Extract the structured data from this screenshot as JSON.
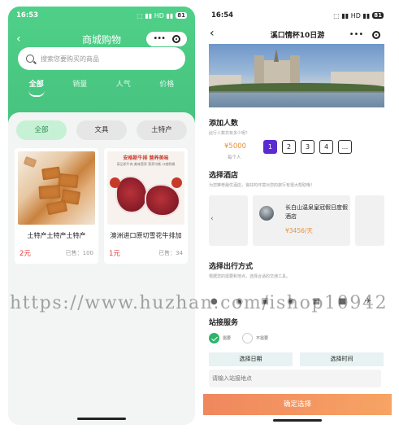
{
  "left": {
    "status": {
      "time": "16:53",
      "signal": "⬚ ▮▮ HD ▮▮",
      "battery": "81"
    },
    "nav": {
      "title": "商城购物",
      "capsule_dots": "•••"
    },
    "search": {
      "placeholder": "搜索您要购买的商品"
    },
    "tabs": [
      "全部",
      "销量",
      "人气",
      "价格"
    ],
    "chips": [
      "全部",
      "文具",
      "土特产"
    ],
    "products": [
      {
        "name": "土特产土特产土特产",
        "price": "2元",
        "sold": "已售：100"
      },
      {
        "name": "澳洲进口原切雪花牛排加",
        "price": "1元",
        "sold": "已售：34",
        "banner": "安格斯牛排 营养美味",
        "banner_sub": "高品质牛肉 美味营养 营养均衡 口感鲜嫩"
      }
    ]
  },
  "right": {
    "status": {
      "time": "16:54",
      "signal": "⬚ ▮▮ HD ▮▮",
      "battery": "81"
    },
    "nav": {
      "title": "溪口情杯10日游",
      "capsule_dots": "•••"
    },
    "add_people": {
      "title": "添加人数",
      "subtitle": "此行人数共有多少呢？",
      "price": "¥5000",
      "unit": "每个人",
      "options": [
        "1",
        "2",
        "3",
        "4",
        "..."
      ]
    },
    "hotel": {
      "title": "选择酒店",
      "subtitle": "为您推荐最优酒店，良好的环境对您的旅行有很大帮助哦！",
      "name": "长白山温泉皇冠假日度假酒店",
      "price": "¥3456/天"
    },
    "transport": {
      "title": "选择出行方式",
      "subtitle": "根据您的需要和地点，选择合适的交通工具。",
      "icons": [
        "bike-icon",
        "car-icon",
        "bus-icon",
        "car-icon",
        "train-icon",
        "lock-icon",
        "plane-icon"
      ]
    },
    "station": {
      "title": "站接服务",
      "need": "需要",
      "no_need": "不需要",
      "date_btn": "选择日期",
      "time_btn": "选择时间",
      "location_placeholder": "请输入站接地点"
    },
    "confirm": "确定选择"
  },
  "watermark": "https://www.huzhan.com/ishop10942",
  "colors": {
    "green": "#46c27e",
    "purple": "#5a2bd1",
    "orange": "#e8913a",
    "red": "#e53935"
  }
}
